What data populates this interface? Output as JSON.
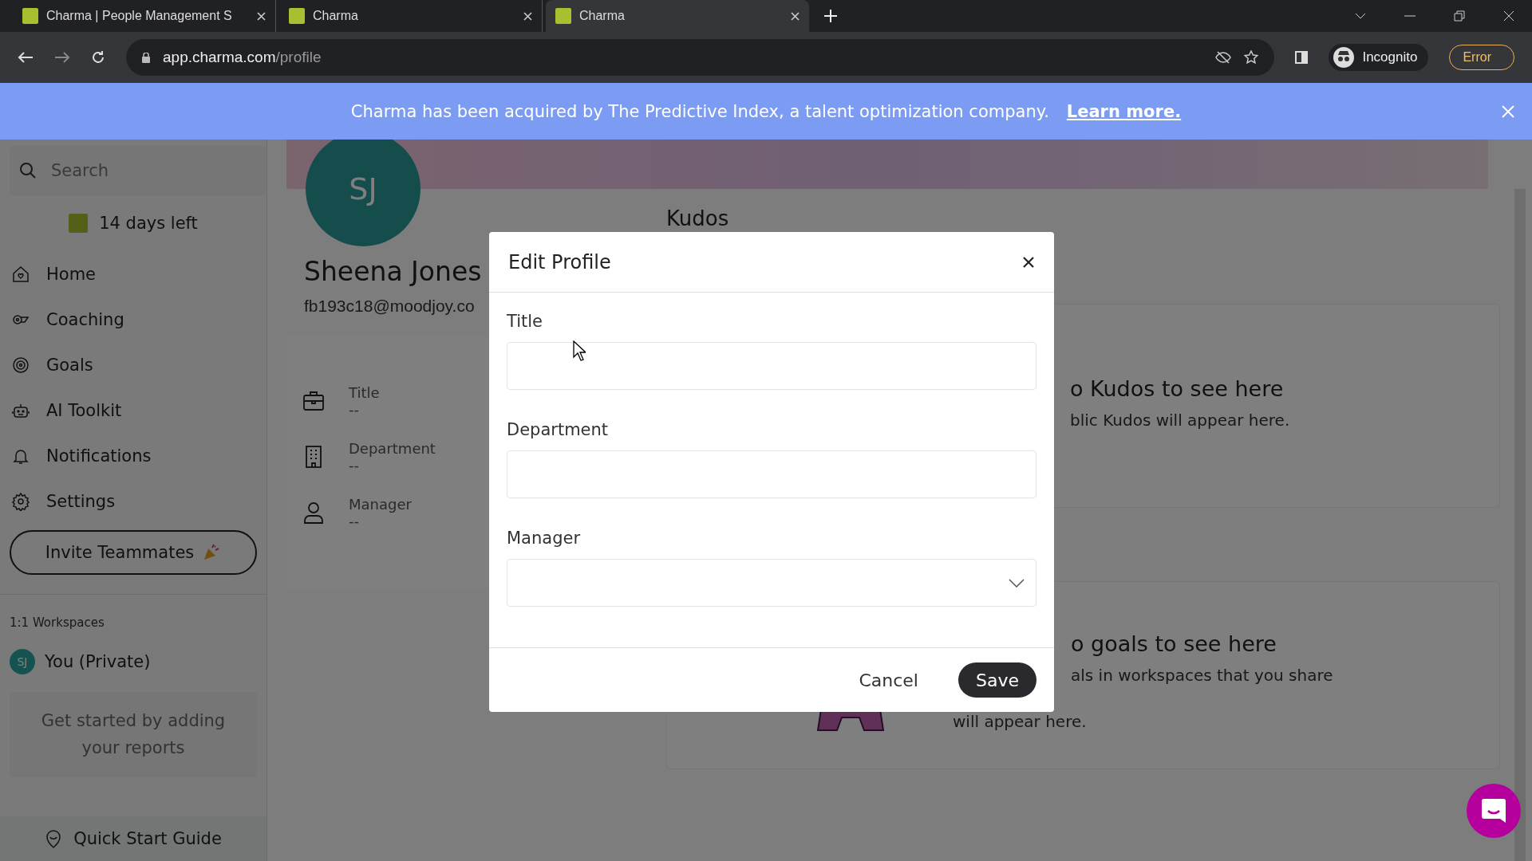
{
  "browser": {
    "tabs": [
      {
        "title": "Charma | People Management S",
        "selected": false
      },
      {
        "title": "Charma",
        "selected": false
      },
      {
        "title": "Charma",
        "selected": true
      }
    ],
    "url_host": "app.charma.com",
    "url_path": "/profile",
    "profile_label": "Incognito",
    "error_label": "Error"
  },
  "banner": {
    "text": "Charma has been acquired by The Predictive Index, a talent optimization company.",
    "link": "Learn more."
  },
  "sidebar": {
    "search": {
      "placeholder": "Search"
    },
    "trial": "14 days left",
    "items": [
      {
        "label": "Home"
      },
      {
        "label": "Coaching"
      },
      {
        "label": "Goals"
      },
      {
        "label": "AI Toolkit"
      },
      {
        "label": "Notifications"
      },
      {
        "label": "Settings"
      }
    ],
    "invite_button": "Invite Teammates",
    "section_title": "1:1 Workspaces",
    "workspaces": [
      {
        "initials": "SJ",
        "name": "You (Private)"
      }
    ],
    "empty_text": "Get started by adding your reports",
    "footer": "Quick Start Guide"
  },
  "profile": {
    "initials": "SJ",
    "name": "Sheena Jones",
    "email": "fb193c18@moodjoy.co",
    "fields": [
      {
        "label": "Title",
        "value": "--"
      },
      {
        "label": "Department",
        "value": "--"
      },
      {
        "label": "Manager",
        "value": "--"
      }
    ]
  },
  "kudos": {
    "heading": "Kudos",
    "empty_title": "o Kudos to see here",
    "empty_text": "blic Kudos will appear here."
  },
  "goals": {
    "empty_title": "o goals to see here",
    "empty_lines": [
      "als in workspaces that you share",
      "will appear here."
    ]
  },
  "modal": {
    "title": "Edit Profile",
    "fields": [
      {
        "label": "Title",
        "kind": "text"
      },
      {
        "label": "Department",
        "kind": "text"
      },
      {
        "label": "Manager",
        "kind": "select"
      }
    ],
    "cancel": "Cancel",
    "save": "Save"
  }
}
